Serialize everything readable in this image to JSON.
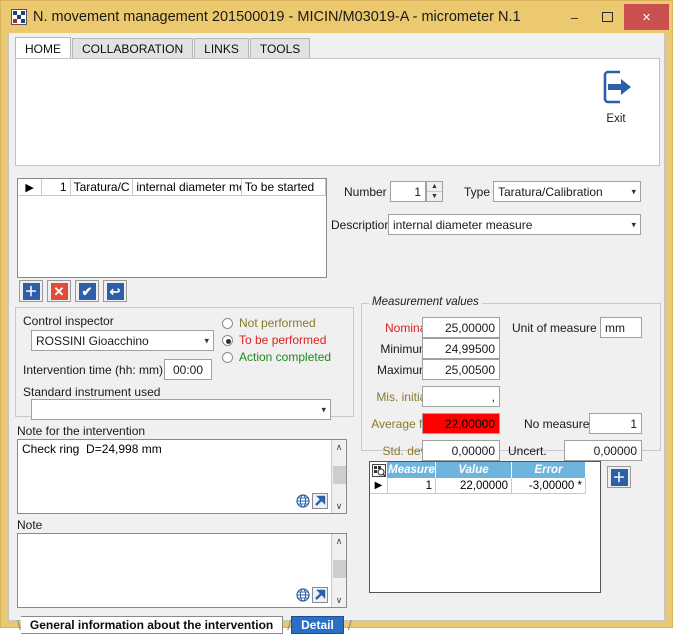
{
  "window": {
    "title": "N. movement management 201500019 - MICIN/M03019-A - micrometer N.1",
    "app_icon": "checkered-squares-icon",
    "minimize_label": "–",
    "maximize_label": "❐",
    "close_label": "×",
    "titlebar_color": "#ecc96e",
    "close_color": "#c9504f",
    "frame_color": "#e9c873"
  },
  "ribbon": {
    "tabs": [
      {
        "label": "HOME",
        "active": true
      },
      {
        "label": "COLLABORATION",
        "active": false
      },
      {
        "label": "LINKS",
        "active": false
      },
      {
        "label": "TOOLS",
        "active": false
      }
    ],
    "exit": {
      "label": "Exit",
      "icon": "exit-door-arrow-icon"
    }
  },
  "list_grid": {
    "row_marker": "▶",
    "columns": [
      "",
      "1",
      "Taratura/C",
      "internal diameter mea",
      "To be started"
    ]
  },
  "crud_toolbar": [
    {
      "name": "add",
      "glyph": "＋",
      "color": "blue"
    },
    {
      "name": "delete",
      "glyph": "✕",
      "color": "red"
    },
    {
      "name": "confirm",
      "glyph": "✔",
      "color": "blue"
    },
    {
      "name": "undo",
      "glyph": "↩",
      "color": "blue"
    }
  ],
  "header_fields": {
    "number_label": "Number",
    "number_value": "1",
    "type_label": "Type",
    "type_value": "Taratura/Calibration",
    "description_label": "Description",
    "description_value": "internal diameter measure"
  },
  "inspector": {
    "title": "Control inspector",
    "inspector_value": "ROSSINI Gioacchino",
    "time_label": "Intervention time (hh: mm)",
    "time_value": "00:00",
    "instrument_label": "Standard instrument used",
    "instrument_value": "",
    "status_options": [
      {
        "label": "Not performed",
        "selected": false,
        "color": "#8a7a2a"
      },
      {
        "label": "To be performed",
        "selected": true,
        "color": "#e02020"
      },
      {
        "label": "Action completed",
        "selected": false,
        "color": "#1f8a1f"
      }
    ]
  },
  "notes": {
    "intervention": {
      "title": "Note for the intervention",
      "value": "Check ring  D=24,998 mm"
    },
    "general": {
      "title": "Note",
      "value": ""
    },
    "icons": {
      "globe": "globe-icon",
      "link": "open-external-arrow-icon"
    },
    "scroll_up": "∧",
    "scroll_down": "∨"
  },
  "measurement_values": {
    "legend": "Measurement values",
    "nominal_label": "Nominal",
    "nominal_value": "25,00000",
    "minimum_label": "Minimum",
    "minimum_value": "24,99500",
    "maximum_label": "Maximum",
    "maximum_value": "25,00500",
    "mis_initial_label": "Mis. initial",
    "mis_initial_value": ",",
    "average_label": "Average fir",
    "average_value": "22,00000",
    "average_highlight": "#ff0000",
    "std_dev_label": "Std. dev.",
    "std_dev_value": "0,00000",
    "unit_label": "Unit of measure",
    "unit_value": "mm",
    "no_measure_label": "No measure",
    "no_measure_value": "1",
    "uncert_label": "Uncert.",
    "uncert_value": "0,00000",
    "label_red": "#e02020",
    "label_olive": "#8a7a2a"
  },
  "measurement_grid": {
    "header_color": "#6fb4dd",
    "corner_icon": "select-all-icon",
    "columns": [
      "Measure",
      "Value",
      "Error"
    ],
    "row_marker": "▶",
    "rows": [
      {
        "measure": "1",
        "value": "22,00000",
        "error": "-3,00000 *"
      }
    ],
    "add_button": {
      "glyph": "＋",
      "name": "add-measure"
    }
  },
  "bottom_tabs": [
    {
      "label": "General information about the intervention",
      "active": false
    },
    {
      "label": "Detail",
      "active": true
    }
  ]
}
